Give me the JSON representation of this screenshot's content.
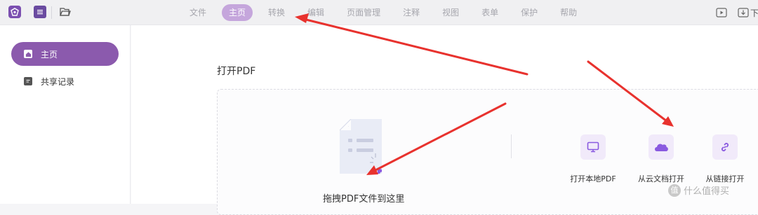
{
  "toolbar": {
    "icons": [
      "app-logo-icon",
      "menu-icon",
      "folder-open-icon",
      "play-icon",
      "download-icon"
    ],
    "tabs": [
      {
        "label": "文件"
      },
      {
        "label": "主页",
        "active": true
      },
      {
        "label": "转换"
      },
      {
        "label": "编辑"
      },
      {
        "label": "页面管理"
      },
      {
        "label": "注释"
      },
      {
        "label": "视图"
      },
      {
        "label": "表单"
      },
      {
        "label": "保护"
      },
      {
        "label": "帮助"
      }
    ],
    "right_partial": "下"
  },
  "sidebar": {
    "items": [
      {
        "label": "主页",
        "icon": "home-icon",
        "active": true
      },
      {
        "label": "共享记录",
        "icon": "document-icon",
        "active": false
      }
    ]
  },
  "main": {
    "title": "打开PDF",
    "drop_text": "拖拽PDF文件到这里",
    "actions": [
      {
        "label": "打开本地PDF",
        "icon": "monitor-icon"
      },
      {
        "label": "从云文档打开",
        "icon": "cloud-icon"
      },
      {
        "label": "从链接打开",
        "icon": "link-icon"
      }
    ]
  },
  "watermark": {
    "text": "什么值得买",
    "mark": "值"
  },
  "colors": {
    "accent": "#8b5aad",
    "tab_active": "#c5a6dc",
    "annotation_arrow": "#e8322e"
  }
}
